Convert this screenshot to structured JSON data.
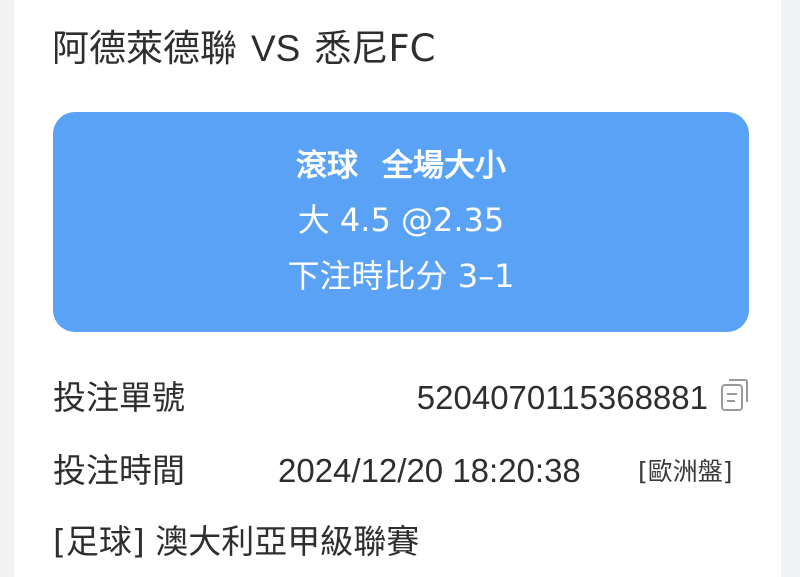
{
  "match": {
    "home_team": "阿德萊德聯",
    "vs": "VS",
    "away_team": "悉尼FC"
  },
  "bet": {
    "type_prefix": "滾球",
    "type_name": "全場大小",
    "selection": "大 4.5 @2.35",
    "score_at_bet": "下注時比分 3–1"
  },
  "details": {
    "ticket_label": "投注單號",
    "ticket_number": "5204070115368881",
    "time_label": "投注時間",
    "time_value": "2024/12/20 18:20:38",
    "odds_format": "[歐洲盤]"
  },
  "league": "[足球] 澳大利亞甲級聯賽",
  "colors": {
    "accent": "#5aa2f6",
    "page_background": "#f1f2f4",
    "card_background": "#ffffff",
    "text": "#2e2e2e"
  },
  "icons": {
    "copy": "copy-icon"
  }
}
